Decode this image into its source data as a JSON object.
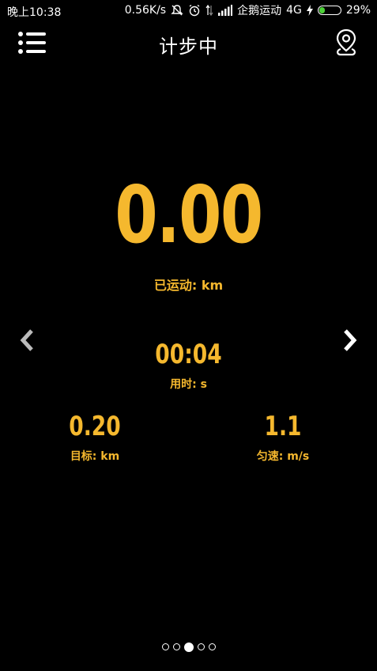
{
  "status_bar": {
    "time": "晚上10:38",
    "network_speed": "0.56K/s",
    "carrier": "企鹅运动",
    "network_type": "4G",
    "battery_percent": "29%",
    "battery_level": 0.29,
    "icons": [
      "mute-icon",
      "alarm-icon",
      "data-arrows-icon",
      "signal-icon",
      "charging-icon",
      "battery-icon"
    ]
  },
  "header": {
    "title": "计步中",
    "menu_icon": "list-menu-icon",
    "location_icon": "map-pin-icon"
  },
  "metrics": {
    "distance": {
      "value": "0.00",
      "label": "已运动: km"
    },
    "time": {
      "value": "00:04",
      "label": "用时: s"
    },
    "target": {
      "value": "0.20",
      "label": "目标: km"
    },
    "speed": {
      "value": "1.1",
      "label": "匀速: m/s"
    }
  },
  "navigation": {
    "prev_icon": "chevron-left-icon",
    "next_icon": "chevron-right-icon"
  },
  "pager": {
    "count": 5,
    "active_index": 2
  },
  "colors": {
    "background": "#000000",
    "accent": "#f5b82e",
    "text": "#ffffff",
    "battery": "#4cd137"
  }
}
